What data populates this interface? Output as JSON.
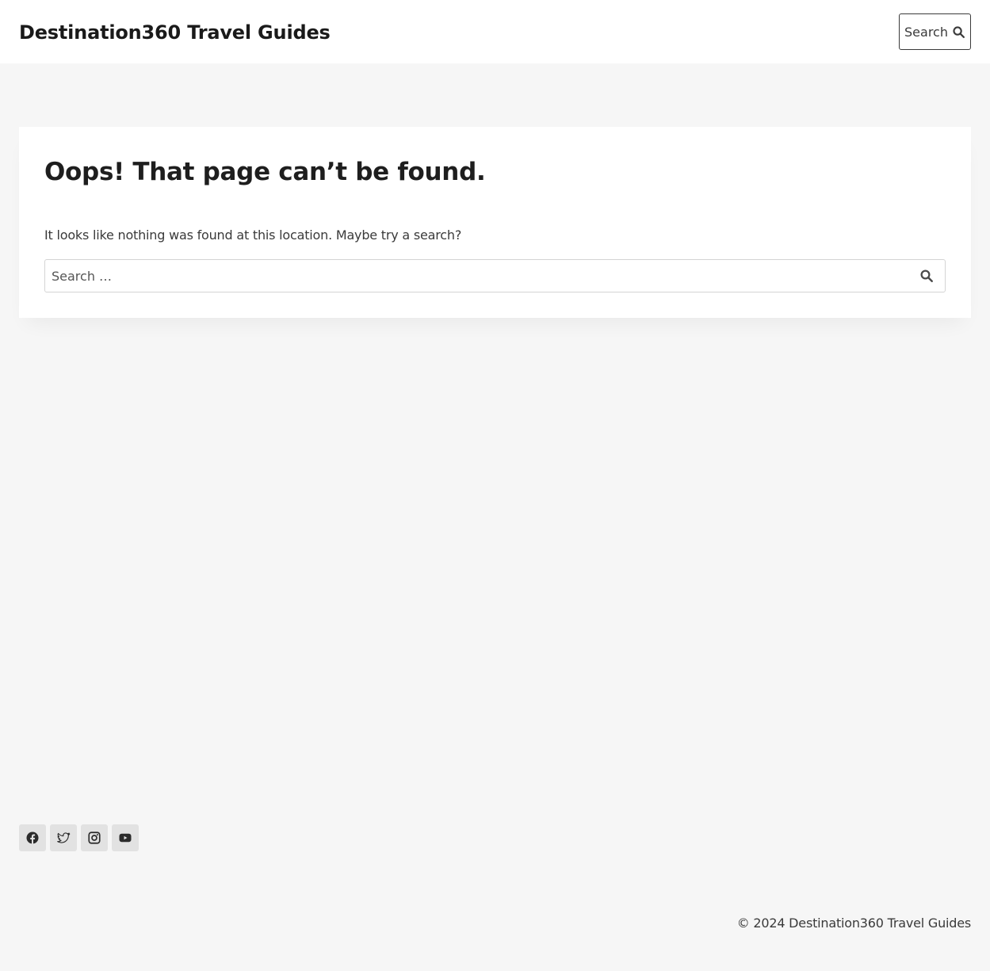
{
  "header": {
    "site_title": "Destination360 Travel Guides",
    "search_button_label": "Search",
    "search_icon": "search-icon"
  },
  "main": {
    "title": "Oops! That page can’t be found.",
    "message": "It looks like nothing was found at this location. Maybe try a search?",
    "search": {
      "placeholder": "Search …",
      "value": "",
      "submit_icon": "search-icon"
    }
  },
  "footer": {
    "social": [
      {
        "name": "Facebook",
        "icon": "facebook-icon"
      },
      {
        "name": "Twitter",
        "icon": "twitter-icon"
      },
      {
        "name": "Instagram",
        "icon": "instagram-icon"
      },
      {
        "name": "YouTube",
        "icon": "youtube-icon"
      }
    ],
    "copyright": "© 2024 Destination360 Travel Guides"
  },
  "colors": {
    "page_background": "#f6f6f6",
    "surface": "#ffffff",
    "text": "#3a3a3a",
    "heading": "#1e1e1e",
    "social_background": "#e2e2e2"
  }
}
